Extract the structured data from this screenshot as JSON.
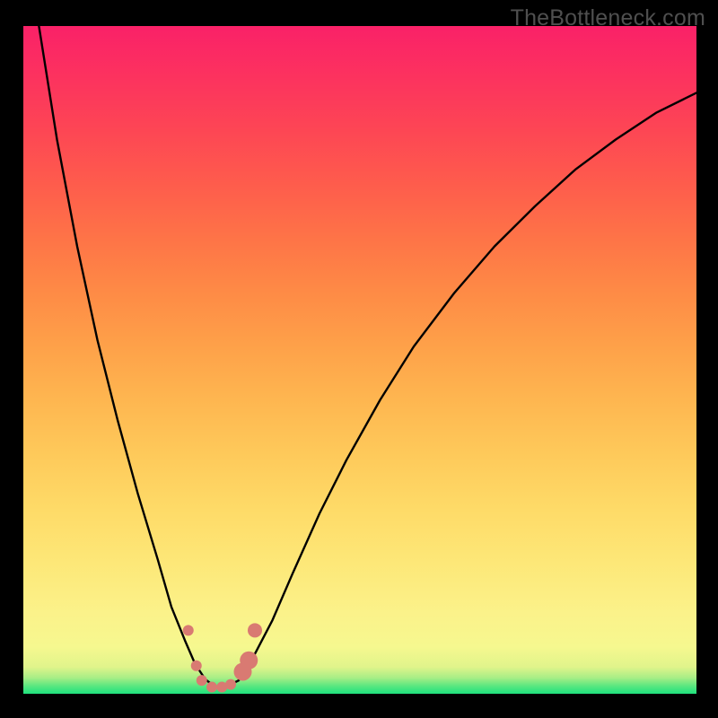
{
  "watermark": "TheBottleneck.com",
  "chart_data": {
    "type": "line",
    "title": "",
    "xlabel": "",
    "ylabel": "",
    "xlim": [
      0,
      100
    ],
    "ylim": [
      0,
      100
    ],
    "series": [
      {
        "name": "curve",
        "x": [
          2,
          5,
          8,
          11,
          14,
          17,
          20,
          22,
          24,
          25.5,
          27,
          28.5,
          30,
          32,
          34,
          37,
          40,
          44,
          48,
          53,
          58,
          64,
          70,
          76,
          82,
          88,
          94,
          100
        ],
        "y": [
          102,
          83,
          67,
          53,
          41,
          30,
          20,
          13,
          8,
          4.5,
          2.2,
          1.0,
          1.0,
          2.0,
          5.2,
          11,
          18,
          27,
          35,
          44,
          52,
          60,
          67,
          73,
          78.5,
          83,
          87,
          90
        ]
      }
    ],
    "markers": [
      {
        "x": 24.5,
        "y": 9.5,
        "r": 6
      },
      {
        "x": 25.7,
        "y": 4.2,
        "r": 6
      },
      {
        "x": 26.5,
        "y": 2.0,
        "r": 6
      },
      {
        "x": 28.0,
        "y": 1.0,
        "r": 6
      },
      {
        "x": 29.5,
        "y": 1.0,
        "r": 6
      },
      {
        "x": 30.8,
        "y": 1.4,
        "r": 6
      },
      {
        "x": 32.6,
        "y": 3.3,
        "r": 10
      },
      {
        "x": 33.5,
        "y": 5.0,
        "r": 10
      },
      {
        "x": 34.4,
        "y": 9.5,
        "r": 8
      }
    ],
    "marker_color": "#d97a72",
    "curve_color": "#000000",
    "gradient_stops": [
      {
        "pos": 0,
        "color": "#1ee27e"
      },
      {
        "pos": 7,
        "color": "#f6f88f"
      },
      {
        "pos": 40,
        "color": "#feba52"
      },
      {
        "pos": 72,
        "color": "#fe6b47"
      },
      {
        "pos": 100,
        "color": "#fa2168"
      }
    ]
  }
}
